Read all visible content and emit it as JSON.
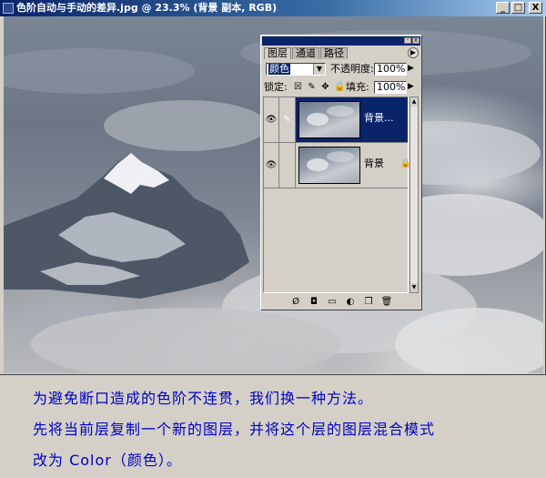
{
  "window": {
    "title": "色阶自动与手动的差异.jpg @ 23.3% (背景 副本, RGB)",
    "buttons": {
      "minimize": "_",
      "maximize": "□",
      "close": "X"
    }
  },
  "layers_palette": {
    "tabs": [
      {
        "label": "图层",
        "active": true
      },
      {
        "label": "通道",
        "active": false
      },
      {
        "label": "路径",
        "active": false
      }
    ],
    "blend_mode": "颜色",
    "opacity_label": "不透明度:",
    "opacity_value": "100%",
    "lock_label": "锁定:",
    "fill_label": "填充:",
    "fill_value": "100%",
    "layers": [
      {
        "name": "背景...",
        "selected": true,
        "visible": true,
        "locked": false
      },
      {
        "name": "背景",
        "selected": false,
        "visible": true,
        "locked": true
      }
    ]
  },
  "caption": {
    "line1": "为避免断口造成的色阶不连贯，我们换一种方法。",
    "line2": "先将当前层复制一个新的图层，并将这个层的图层混合模式",
    "line3": "改为 Color（颜色）。"
  },
  "colors": {
    "titlebar": "#0a246a",
    "caption_text": "#0000c0",
    "panel_bg": "#d4d0c8"
  }
}
